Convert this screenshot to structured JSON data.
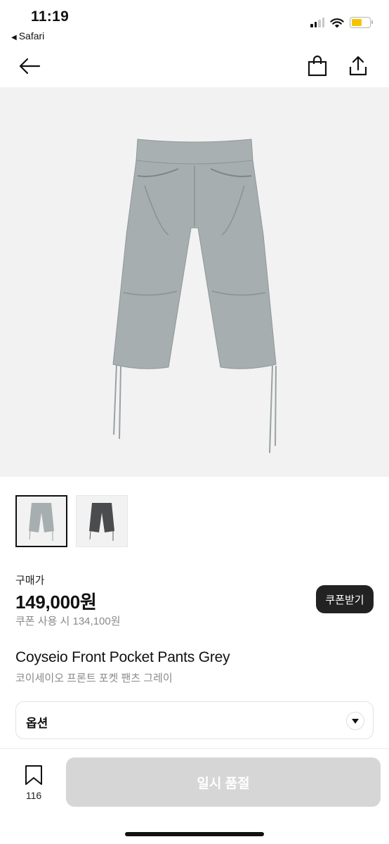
{
  "status_bar": {
    "time": "11:19",
    "back_app": "Safari",
    "back_glyph": "◀",
    "battery_color": "#f5c400"
  },
  "nav": {
    "back_icon": "arrow-left-icon",
    "cart_icon": "shopping-bag-icon",
    "share_icon": "share-icon"
  },
  "product": {
    "price_label": "구매가",
    "price": "149,000원",
    "coupon_price": "쿠폰 사용 시 134,100원",
    "coupon_button": "쿠폰받기",
    "title_en": "Coyseio Front Pocket Pants Grey",
    "title_ko": "코이세이오 프론트 포켓 팬츠 그레이",
    "thumbnails": [
      {
        "color": "#a7aeb0",
        "selected": true
      },
      {
        "color": "#4a4c4e",
        "selected": false
      }
    ],
    "main_color": "#a7aeb0"
  },
  "option": {
    "label": "옵션"
  },
  "bottom_bar": {
    "wish_count": "116",
    "buy_button": "일시 품절",
    "buy_button_color": "#d6d6d6"
  }
}
